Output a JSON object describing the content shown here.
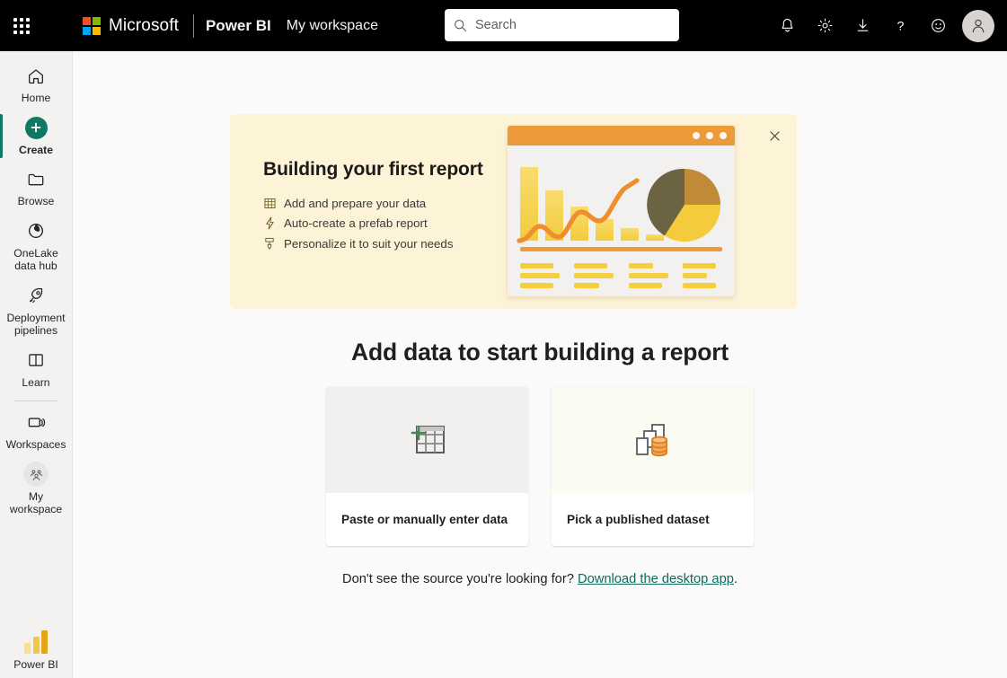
{
  "topbar": {
    "waffle_label": "app-launcher",
    "microsoft": "Microsoft",
    "product": "Power BI",
    "workspace": "My workspace",
    "search": {
      "value": "",
      "placeholder": "Search",
      "icon": "search-icon"
    },
    "actions": [
      {
        "name": "notifications",
        "icon": "bell-icon",
        "label": "Notifications"
      },
      {
        "name": "settings",
        "icon": "gear-icon",
        "label": "Settings"
      },
      {
        "name": "download",
        "icon": "download-icon",
        "label": "Download"
      },
      {
        "name": "help",
        "icon": "question-icon",
        "label": "Help"
      },
      {
        "name": "feedback",
        "icon": "smiley-icon",
        "label": "Feedback"
      }
    ],
    "avatar": {
      "icon": "person-icon",
      "label": "Account manager"
    }
  },
  "sidebar": {
    "items": [
      {
        "label": "Home",
        "icon": "home-icon",
        "selected": false
      },
      {
        "label": "Create",
        "icon": "plus-circle-icon",
        "selected": true
      },
      {
        "label": "Browse",
        "icon": "folder-icon",
        "selected": false
      },
      {
        "label": "OneLake data hub",
        "icon": "onelake-icon",
        "selected": false
      },
      {
        "label": "Deployment pipelines",
        "icon": "rocket-icon",
        "selected": false
      },
      {
        "label": "Learn",
        "icon": "book-icon",
        "selected": false
      },
      {
        "label": "Workspaces",
        "icon": "workspaces-icon",
        "selected": false
      },
      {
        "label": "My workspace",
        "icon": "people-group-icon",
        "selected": false
      }
    ],
    "footer": {
      "label": "Power BI",
      "icon": "powerbi-logo-icon"
    },
    "accent_color": "#117865"
  },
  "banner": {
    "title": "Building your first report",
    "items": [
      {
        "icon": "table-grid-icon",
        "text": "Add and prepare your data"
      },
      {
        "icon": "lightning-bolt-icon",
        "text": "Auto-create a prefab report"
      },
      {
        "icon": "paintbrush-icon",
        "text": "Personalize it to suit your needs"
      }
    ],
    "close_label": "✕",
    "background_color": "#fdf3d6",
    "illustration": {
      "name": "report-illustration",
      "accent_color": "#ed9b3a",
      "bar_color": "#f3cb3c"
    }
  },
  "main": {
    "heading": "Add data to start building a report",
    "cards": [
      {
        "label": "Paste or manually enter data",
        "icon": "table-plus-icon",
        "icon_bg": "#f1f0ef"
      },
      {
        "label": "Pick a published dataset",
        "icon": "dataset-icon",
        "icon_bg": "#fbfbf1"
      }
    ],
    "footer_text": "Don't see the source you're looking for?",
    "footer_link": "Download the desktop app",
    "footer_suffix": ".",
    "link_color": "#0f6b5c"
  }
}
